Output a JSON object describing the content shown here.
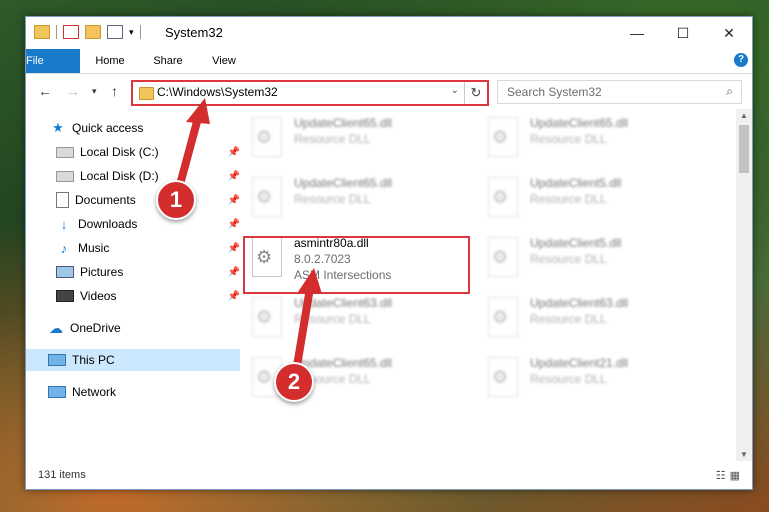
{
  "window": {
    "title": "System32"
  },
  "ribbon": {
    "tabs": [
      "File",
      "Home",
      "Share",
      "View"
    ],
    "help": "?"
  },
  "address": {
    "path": "C:\\Windows\\System32"
  },
  "search": {
    "placeholder": "Search System32"
  },
  "nav": {
    "quick_access": "Quick access",
    "items": [
      "Local Disk (C:)",
      "Local Disk (D:)",
      "Documents",
      "Downloads",
      "Music",
      "Pictures",
      "Videos"
    ],
    "onedrive": "OneDrive",
    "this_pc": "This PC",
    "network": "Network"
  },
  "files": {
    "highlighted": {
      "name": "asmintr80a.dll",
      "version": "8.0.2.7023",
      "description": "ASM Intersections"
    },
    "blurred": [
      {
        "name": "UpdateClient65.dll",
        "desc": "Resource DLL"
      },
      {
        "name": "UpdateClient65.dll",
        "desc": "Resource DLL"
      },
      {
        "name": "UpdateClient65.dll",
        "desc": "Resource DLL"
      },
      {
        "name": "UpdateClient5.dll",
        "desc": "Resource DLL"
      },
      {
        "name": "UpdateClient5.dll",
        "desc": "Resource DLL"
      },
      {
        "name": "UpdateClient63.dll",
        "desc": "Resource DLL"
      },
      {
        "name": "UpdateClient63.dll",
        "desc": "Resource DLL"
      },
      {
        "name": "UpdateClient65.dll",
        "desc": "Resource DLL"
      },
      {
        "name": "UpdateClient21.dll",
        "desc": "Resource DLL"
      }
    ]
  },
  "status": {
    "count": "131 items"
  },
  "callouts": {
    "one": "1",
    "two": "2"
  },
  "colors": {
    "accent": "#1979ca",
    "highlight": "#d9363e",
    "callout": "#d32d2d"
  }
}
